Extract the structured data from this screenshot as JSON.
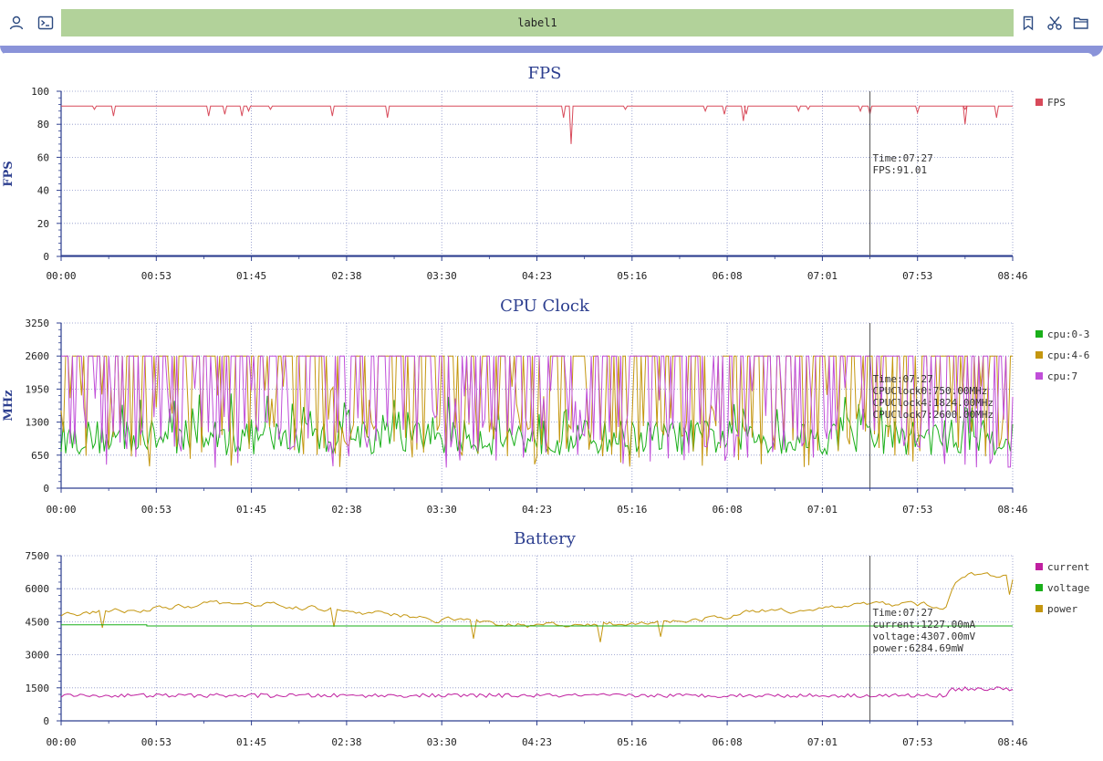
{
  "toolbar": {
    "label": "label1",
    "icons": [
      "user-icon",
      "terminal-icon",
      "bookmark-icon",
      "scissors-icon",
      "folder-icon"
    ]
  },
  "x_ticks": [
    "00:00",
    "00:53",
    "01:45",
    "02:38",
    "03:30",
    "04:23",
    "05:16",
    "06:08",
    "07:01",
    "07:53",
    "08:46"
  ],
  "chart_data": [
    {
      "type": "line",
      "title": "FPS",
      "ylabel": "FPS",
      "xlabel": "",
      "ylim": [
        0,
        100
      ],
      "y_ticks": [
        "0",
        "20",
        "40",
        "60",
        "80",
        "100"
      ],
      "legend": [
        "FPS"
      ],
      "colors": [
        "#d84a5a"
      ],
      "grid": true,
      "legend_position": "right",
      "series": [
        {
          "name": "FPS",
          "base": 91,
          "dips": [
            [
              0.035,
              89
            ],
            [
              0.055,
              85
            ],
            [
              0.155,
              85
            ],
            [
              0.172,
              86
            ],
            [
              0.19,
              85
            ],
            [
              0.197,
              88
            ],
            [
              0.22,
              89
            ],
            [
              0.285,
              85
            ],
            [
              0.343,
              84
            ],
            [
              0.528,
              84
            ],
            [
              0.536,
              68
            ],
            [
              0.593,
              89
            ],
            [
              0.677,
              88
            ],
            [
              0.697,
              86
            ],
            [
              0.717,
              82
            ],
            [
              0.72,
              86
            ],
            [
              0.775,
              88
            ],
            [
              0.785,
              89
            ],
            [
              0.84,
              88
            ],
            [
              0.85,
              86
            ],
            [
              0.9,
              87
            ],
            [
              0.95,
              89
            ],
            [
              0.95,
              80
            ],
            [
              0.983,
              84
            ]
          ]
        }
      ],
      "tooltip": [
        "Time:07:27",
        "FPS:91.01"
      ],
      "cursor_time_fraction": 0.85
    },
    {
      "type": "line",
      "title": "CPU Clock",
      "ylabel": "MHz",
      "xlabel": "",
      "ylim": [
        0,
        3250
      ],
      "y_ticks": [
        "0",
        "650",
        "1300",
        "1950",
        "2600",
        "3250"
      ],
      "legend": [
        "cpu:0-3",
        "cpu:4-6",
        "cpu:7"
      ],
      "colors": [
        "#1aaf1a",
        "#c4960f",
        "#c04ed8"
      ],
      "grid": true,
      "legend_position": "right",
      "series": [
        {
          "name": "cpu:0-3",
          "min": 600,
          "max": 2000,
          "base": 1000
        },
        {
          "name": "cpu:4-6",
          "min": 400,
          "max": 2600,
          "base": 2600
        },
        {
          "name": "cpu:7",
          "min": 650,
          "max": 2600,
          "base": 2600
        }
      ],
      "tooltip": [
        "Time:07:27",
        "CPUClock0:750.00MHz",
        "CPUClock4:1824.00MHz",
        "CPUClock7:2600.00MHz"
      ],
      "cursor_time_fraction": 0.85
    },
    {
      "type": "line",
      "title": "Battery",
      "ylabel": "",
      "xlabel": "",
      "ylim": [
        0,
        7500
      ],
      "y_ticks": [
        "0",
        "1500",
        "3000",
        "4500",
        "6000",
        "7500"
      ],
      "legend": [
        "current",
        "voltage",
        "power"
      ],
      "colors": [
        "#c020a0",
        "#1aaf1a",
        "#c4960f"
      ],
      "grid": true,
      "legend_position": "right",
      "series": [
        {
          "name": "current",
          "level": 1200
        },
        {
          "name": "voltage",
          "level": 4307
        },
        {
          "name": "power",
          "level": 5000
        }
      ],
      "tooltip": [
        "Time:07:27",
        "current:1227.00mA",
        "voltage:4307.00mV",
        "power:6284.69mW"
      ],
      "cursor_time_fraction": 0.85
    }
  ]
}
